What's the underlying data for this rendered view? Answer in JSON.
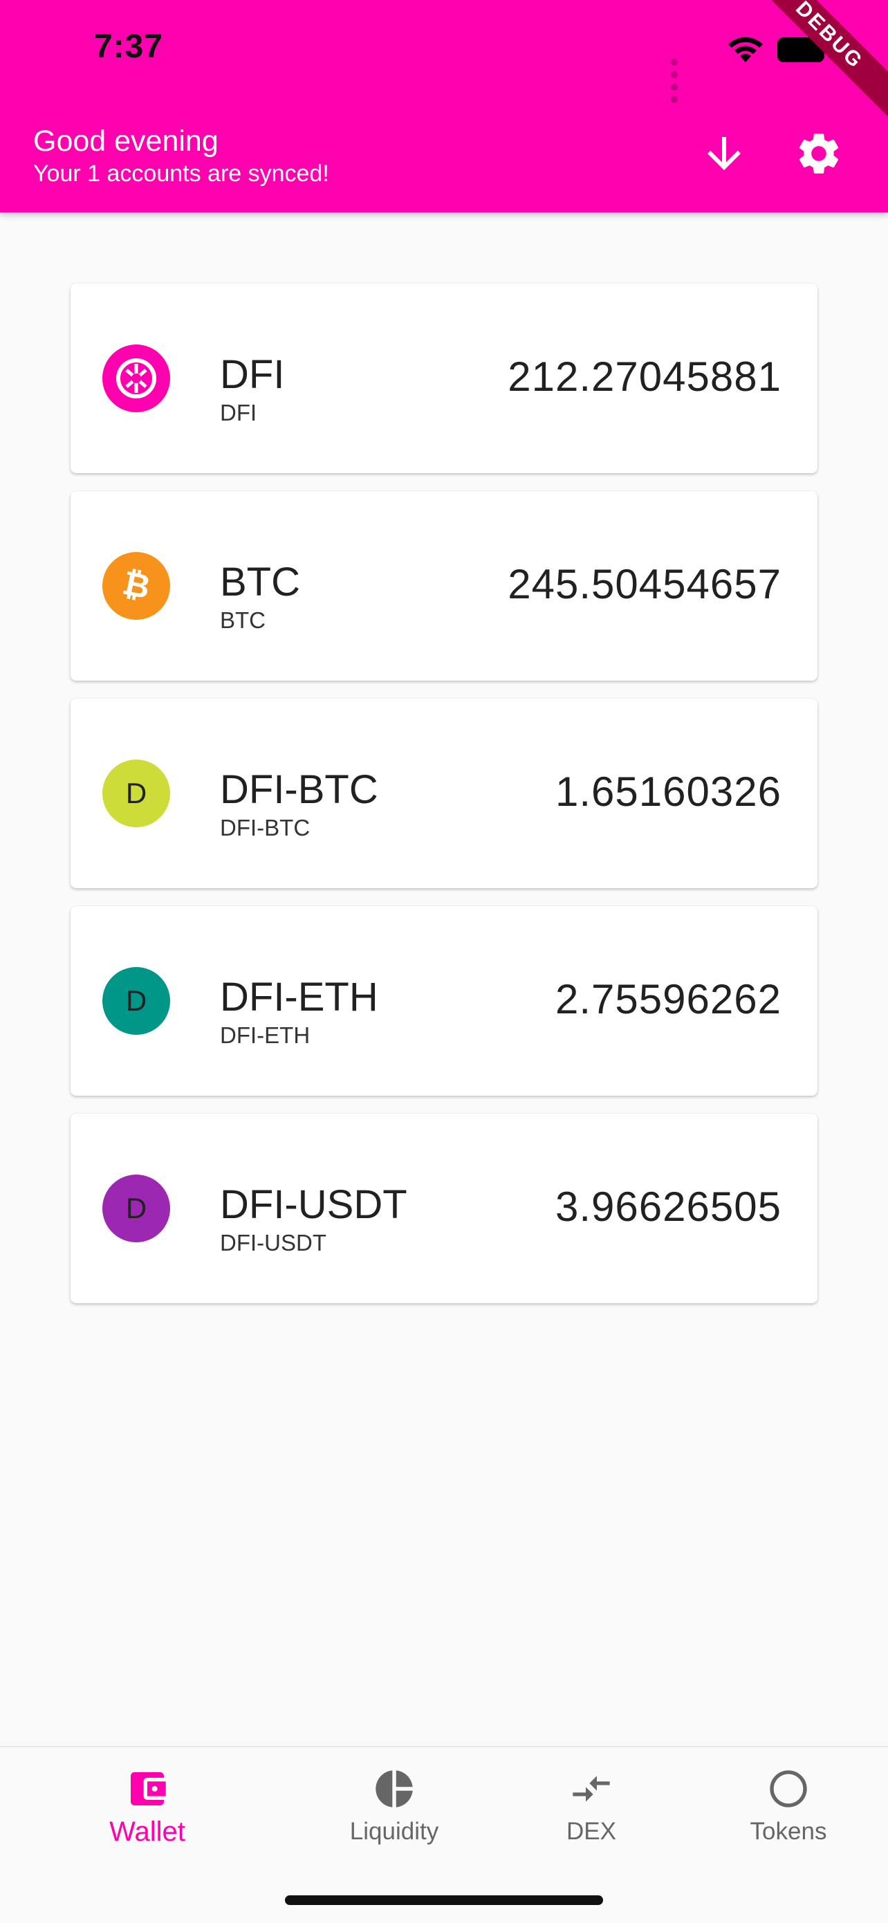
{
  "status_bar": {
    "time": "7:37"
  },
  "debug_banner": "DEBUG",
  "header": {
    "title": "Good evening",
    "subtitle": "Your 1 accounts are synced!",
    "receive_icon": "arrow-down-icon",
    "settings_icon": "gear-icon"
  },
  "colors": {
    "accent": "#ff00af",
    "btc": "#f7931a",
    "dfi_btc": "#cddc39",
    "dfi_eth": "#009688",
    "dfi_usdt": "#9c27b0"
  },
  "tokens": [
    {
      "name": "DFI",
      "symbol": "DFI",
      "balance": "212.27045881"
    },
    {
      "name": "BTC",
      "symbol": "BTC",
      "balance": "245.50454657"
    },
    {
      "name": "DFI-BTC",
      "symbol": "DFI-BTC",
      "balance": "1.65160326",
      "avatar_letter": "D"
    },
    {
      "name": "DFI-ETH",
      "symbol": "DFI-ETH",
      "balance": "2.75596262",
      "avatar_letter": "D"
    },
    {
      "name": "DFI-USDT",
      "symbol": "DFI-USDT",
      "balance": "3.96626505",
      "avatar_letter": "D"
    }
  ],
  "bottom_nav": [
    {
      "label": "Wallet",
      "icon": "wallet-icon",
      "active": true
    },
    {
      "label": "Liquidity",
      "icon": "pie-chart-icon",
      "active": false
    },
    {
      "label": "DEX",
      "icon": "swap-icon",
      "active": false
    },
    {
      "label": "Tokens",
      "icon": "circle-icon",
      "active": false
    }
  ]
}
